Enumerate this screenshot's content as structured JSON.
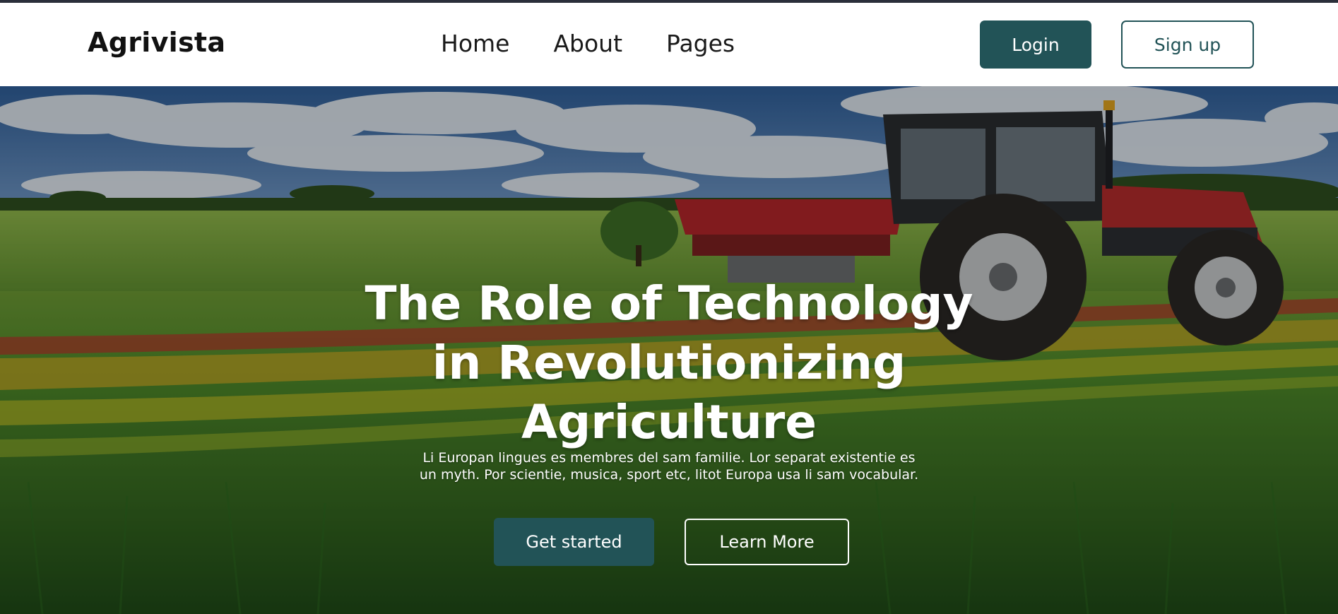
{
  "navbar": {
    "brand": "Agrivista",
    "links": [
      {
        "label": "Home"
      },
      {
        "label": "About"
      },
      {
        "label": "Pages"
      }
    ],
    "login_label": "Login",
    "signup_label": "Sign up"
  },
  "hero": {
    "title_lines": [
      "The Role of Technology",
      "in Revolutionizing",
      "Agriculture"
    ],
    "subtitle_lines": [
      "Li Europan lingues es membres del sam familie. Lor separat existentie es",
      "un myth. Por scientie, musica, sport etc, litot Europa usa li sam vocabular."
    ],
    "primary_button": "Get started",
    "secondary_button": "Learn More",
    "image_description_icon": "tractor-field-image"
  },
  "colors": {
    "accent": "#225357",
    "text_dark": "#111111",
    "white": "#ffffff"
  }
}
